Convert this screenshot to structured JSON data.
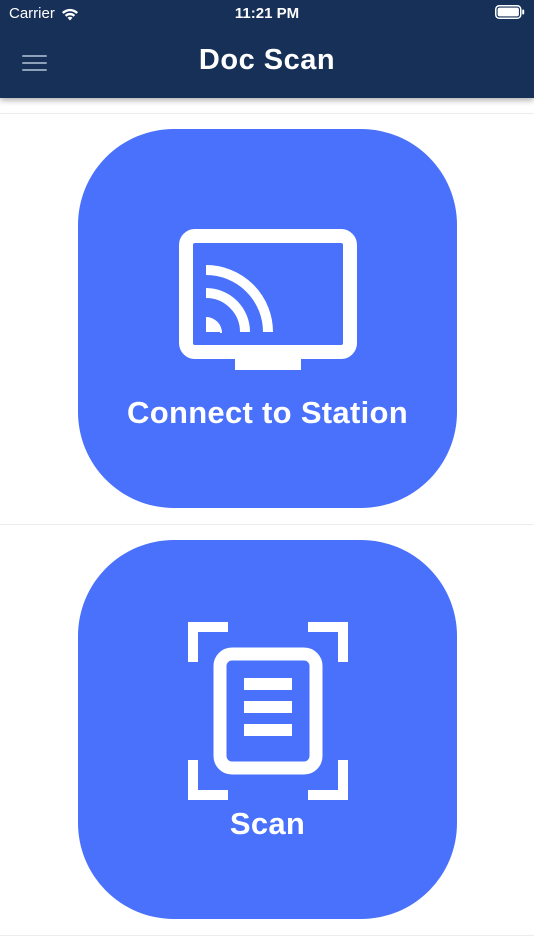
{
  "status_bar": {
    "carrier": "Carrier",
    "time": "11:21 PM",
    "wifi_icon": "wifi-icon",
    "battery_icon": "battery-icon"
  },
  "header": {
    "title": "Doc Scan",
    "menu_icon": "hamburger-menu-icon",
    "background_color": "#163057"
  },
  "tiles": [
    {
      "label": "Connect to Station",
      "icon": "cast-icon"
    },
    {
      "label": "Scan",
      "icon": "document-scan-icon"
    }
  ],
  "colors": {
    "tile": "#4a71fc",
    "text": "#ffffff"
  }
}
